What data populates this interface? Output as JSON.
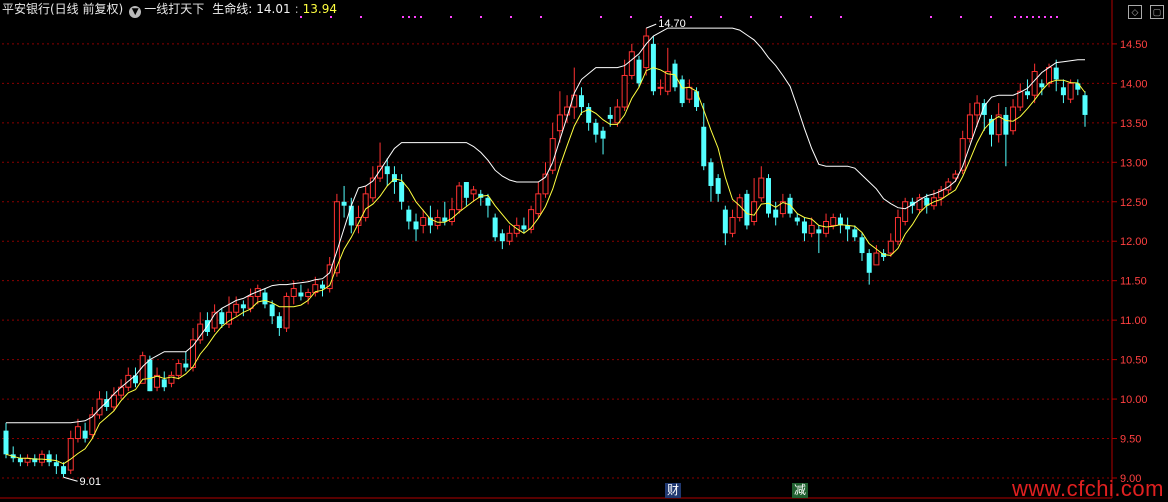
{
  "header": {
    "stock_title": "平安银行(日线 前复权)",
    "menu_glyph": "▼",
    "indicator_name": "一线打天下",
    "line_label": "生命线:",
    "value1": "14.01",
    "value2": "13.94"
  },
  "events": {
    "cai": "财",
    "jian": "减"
  },
  "watermark": "www.cfchi.com",
  "colors": {
    "up": "#ff3232",
    "down": "#54ffff",
    "grid": "#8a0000",
    "axis": "#b00000",
    "ma": "#ffff40",
    "life": "#ffffff",
    "tick": "#ff4040",
    "dots": "#ff40ff"
  },
  "chart_data": {
    "type": "candlestick",
    "ylim": [
      9.0,
      14.6
    ],
    "yticks": [
      "9.00",
      "9.50",
      "10.00",
      "10.50",
      "11.00",
      "11.50",
      "12.00",
      "12.50",
      "13.00",
      "13.50",
      "14.00",
      "14.50"
    ],
    "max_label": "14.70",
    "min_label": "9.01",
    "candles": [
      [
        9.6,
        9.3,
        9.7,
        9.25
      ],
      [
        9.3,
        9.25,
        9.4,
        9.2
      ],
      [
        9.25,
        9.2,
        9.3,
        9.15
      ],
      [
        9.2,
        9.25,
        9.3,
        9.15
      ],
      [
        9.25,
        9.2,
        9.3,
        9.15
      ],
      [
        9.2,
        9.3,
        9.35,
        9.15
      ],
      [
        9.3,
        9.2,
        9.35,
        9.15
      ],
      [
        9.2,
        9.15,
        9.3,
        9.05
      ],
      [
        9.15,
        9.05,
        9.2,
        9.01
      ],
      [
        9.1,
        9.5,
        9.6,
        9.05
      ],
      [
        9.5,
        9.65,
        9.75,
        9.45
      ],
      [
        9.6,
        9.5,
        9.7,
        9.45
      ],
      [
        9.55,
        9.8,
        9.9,
        9.5
      ],
      [
        9.8,
        10.0,
        10.1,
        9.75
      ],
      [
        10.0,
        9.9,
        10.1,
        9.85
      ],
      [
        9.9,
        10.05,
        10.15,
        9.85
      ],
      [
        10.05,
        10.15,
        10.25,
        10.0
      ],
      [
        10.15,
        10.3,
        10.4,
        10.1
      ],
      [
        10.3,
        10.2,
        10.4,
        10.15
      ],
      [
        10.2,
        10.55,
        10.6,
        10.2
      ],
      [
        10.5,
        10.1,
        10.55,
        10.1
      ],
      [
        10.15,
        10.3,
        10.4,
        10.1
      ],
      [
        10.25,
        10.15,
        10.35,
        10.1
      ],
      [
        10.2,
        10.3,
        10.35,
        10.15
      ],
      [
        10.3,
        10.45,
        10.5,
        10.25
      ],
      [
        10.45,
        10.4,
        10.6,
        10.35
      ],
      [
        10.4,
        10.75,
        10.9,
        10.35
      ],
      [
        10.75,
        10.95,
        11.1,
        10.7
      ],
      [
        11.0,
        10.85,
        11.1,
        10.8
      ],
      [
        10.9,
        11.1,
        11.2,
        10.85
      ],
      [
        11.1,
        10.95,
        11.15,
        10.9
      ],
      [
        10.95,
        11.1,
        11.3,
        10.9
      ],
      [
        11.1,
        11.2,
        11.3,
        11.05
      ],
      [
        11.2,
        11.15,
        11.25,
        11.05
      ],
      [
        11.15,
        11.3,
        11.4,
        11.1
      ],
      [
        11.3,
        11.4,
        11.45,
        11.2
      ],
      [
        11.35,
        11.2,
        11.4,
        11.15
      ],
      [
        11.2,
        11.05,
        11.25,
        10.95
      ],
      [
        11.05,
        10.9,
        11.1,
        10.8
      ],
      [
        10.9,
        11.3,
        11.35,
        10.85
      ],
      [
        11.3,
        11.4,
        11.5,
        11.2
      ],
      [
        11.35,
        11.3,
        11.45,
        11.25
      ],
      [
        11.3,
        11.35,
        11.4,
        11.2
      ],
      [
        11.35,
        11.45,
        11.55,
        11.3
      ],
      [
        11.45,
        11.4,
        11.5,
        11.3
      ],
      [
        11.4,
        11.7,
        11.8,
        11.35
      ],
      [
        11.6,
        12.5,
        12.6,
        11.55
      ],
      [
        12.5,
        12.45,
        12.7,
        12.3
      ],
      [
        12.45,
        12.2,
        12.55,
        12.1
      ],
      [
        12.2,
        12.3,
        12.45,
        12.1
      ],
      [
        12.3,
        12.6,
        12.7,
        12.25
      ],
      [
        12.55,
        12.8,
        12.95,
        12.5
      ],
      [
        12.8,
        12.95,
        13.25,
        12.75
      ],
      [
        12.95,
        12.85,
        13.05,
        12.7
      ],
      [
        12.85,
        12.75,
        12.95,
        12.6
      ],
      [
        12.75,
        12.5,
        12.85,
        12.4
      ],
      [
        12.4,
        12.25,
        12.45,
        12.15
      ],
      [
        12.25,
        12.15,
        12.35,
        12.0
      ],
      [
        12.2,
        12.3,
        12.4,
        12.1
      ],
      [
        12.3,
        12.2,
        12.45,
        12.1
      ],
      [
        12.2,
        12.3,
        12.4,
        12.15
      ],
      [
        12.3,
        12.25,
        12.5,
        12.2
      ],
      [
        12.25,
        12.4,
        12.55,
        12.2
      ],
      [
        12.4,
        12.7,
        12.75,
        12.35
      ],
      [
        12.75,
        12.55,
        12.75,
        12.45
      ],
      [
        12.6,
        12.65,
        12.7,
        12.5
      ],
      [
        12.6,
        12.55,
        12.65,
        12.45
      ],
      [
        12.55,
        12.45,
        12.6,
        12.3
      ],
      [
        12.3,
        12.05,
        12.35,
        12.0
      ],
      [
        12.1,
        12.0,
        12.15,
        11.9
      ],
      [
        12.0,
        12.1,
        12.2,
        11.95
      ],
      [
        12.1,
        12.2,
        12.3,
        12.05
      ],
      [
        12.2,
        12.15,
        12.3,
        12.1
      ],
      [
        12.15,
        12.4,
        12.45,
        12.1
      ],
      [
        12.35,
        12.6,
        12.75,
        12.3
      ],
      [
        12.6,
        12.85,
        13.0,
        12.55
      ],
      [
        12.9,
        13.3,
        13.5,
        12.85
      ],
      [
        13.4,
        13.6,
        13.9,
        13.25
      ],
      [
        13.6,
        13.7,
        13.85,
        13.5
      ],
      [
        13.7,
        13.85,
        14.2,
        13.55
      ],
      [
        13.85,
        13.7,
        13.95,
        13.6
      ],
      [
        13.7,
        13.5,
        13.75,
        13.4
      ],
      [
        13.5,
        13.35,
        13.55,
        13.25
      ],
      [
        13.4,
        13.3,
        13.45,
        13.1
      ],
      [
        13.6,
        13.55,
        13.7,
        13.45
      ],
      [
        13.5,
        13.7,
        13.8,
        13.45
      ],
      [
        13.7,
        14.1,
        14.3,
        13.65
      ],
      [
        14.1,
        14.4,
        14.5,
        14.05
      ],
      [
        14.3,
        14.0,
        14.35,
        13.95
      ],
      [
        14.2,
        14.6,
        14.7,
        14.1
      ],
      [
        14.5,
        13.9,
        14.6,
        13.85
      ],
      [
        13.95,
        13.95,
        14.05,
        13.85
      ],
      [
        13.9,
        14.15,
        14.45,
        13.85
      ],
      [
        14.25,
        13.95,
        14.3,
        13.9
      ],
      [
        14.05,
        13.75,
        14.1,
        13.7
      ],
      [
        13.8,
        13.95,
        14.05,
        13.75
      ],
      [
        13.9,
        13.7,
        13.95,
        13.65
      ],
      [
        13.45,
        12.95,
        13.75,
        12.9
      ],
      [
        13.0,
        12.7,
        13.05,
        12.5
      ],
      [
        12.8,
        12.6,
        12.85,
        12.5
      ],
      [
        12.4,
        12.1,
        12.45,
        11.95
      ],
      [
        12.1,
        12.3,
        12.4,
        12.05
      ],
      [
        12.3,
        12.55,
        12.6,
        12.25
      ],
      [
        12.6,
        12.2,
        12.65,
        12.15
      ],
      [
        12.25,
        12.5,
        12.8,
        12.2
      ],
      [
        12.55,
        12.8,
        12.95,
        12.5
      ],
      [
        12.8,
        12.35,
        12.85,
        12.3
      ],
      [
        12.4,
        12.3,
        12.5,
        12.2
      ],
      [
        12.35,
        12.5,
        12.6,
        12.3
      ],
      [
        12.55,
        12.35,
        12.6,
        12.3
      ],
      [
        12.3,
        12.25,
        12.35,
        12.2
      ],
      [
        12.25,
        12.1,
        12.3,
        12.0
      ],
      [
        12.1,
        12.2,
        12.3,
        12.05
      ],
      [
        12.15,
        12.1,
        12.2,
        11.85
      ],
      [
        12.1,
        12.25,
        12.35,
        12.05
      ],
      [
        12.2,
        12.3,
        12.35,
        12.15
      ],
      [
        12.3,
        12.2,
        12.35,
        12.1
      ],
      [
        12.2,
        12.15,
        12.3,
        12.0
      ],
      [
        12.15,
        12.05,
        12.2,
        12.0
      ],
      [
        12.05,
        11.85,
        12.1,
        11.75
      ],
      [
        11.85,
        11.6,
        11.9,
        11.45
      ],
      [
        11.7,
        11.85,
        11.95,
        11.7
      ],
      [
        11.85,
        11.8,
        11.9,
        11.75
      ],
      [
        11.85,
        12.0,
        12.1,
        11.8
      ],
      [
        12.0,
        12.3,
        12.4,
        11.95
      ],
      [
        12.25,
        12.5,
        12.55,
        12.2
      ],
      [
        12.5,
        12.45,
        12.55,
        12.35
      ],
      [
        12.4,
        12.55,
        12.6,
        12.35
      ],
      [
        12.55,
        12.45,
        12.6,
        12.35
      ],
      [
        12.45,
        12.55,
        12.65,
        12.4
      ],
      [
        12.55,
        12.65,
        12.7,
        12.45
      ],
      [
        12.65,
        12.75,
        12.8,
        12.6
      ],
      [
        12.8,
        12.85,
        12.9,
        12.75
      ],
      [
        12.9,
        13.3,
        13.4,
        12.85
      ],
      [
        13.3,
        13.6,
        13.75,
        13.25
      ],
      [
        13.6,
        13.75,
        13.85,
        13.45
      ],
      [
        13.75,
        13.6,
        13.8,
        13.4
      ],
      [
        13.55,
        13.35,
        13.6,
        13.2
      ],
      [
        13.35,
        13.6,
        13.75,
        13.25
      ],
      [
        13.6,
        13.35,
        13.7,
        12.95
      ],
      [
        13.4,
        13.7,
        13.8,
        13.35
      ],
      [
        13.7,
        13.9,
        14.0,
        13.65
      ],
      [
        13.9,
        13.85,
        14.05,
        13.8
      ],
      [
        13.85,
        14.15,
        14.25,
        13.75
      ],
      [
        14.0,
        13.95,
        14.05,
        13.85
      ],
      [
        14.0,
        14.2,
        14.25,
        13.95
      ],
      [
        14.2,
        14.05,
        14.3,
        13.9
      ],
      [
        13.95,
        13.85,
        14.05,
        13.75
      ],
      [
        13.8,
        14.0,
        14.05,
        13.75
      ],
      [
        14.0,
        13.92,
        14.05,
        13.85
      ],
      [
        13.85,
        13.6,
        13.9,
        13.45
      ]
    ]
  }
}
